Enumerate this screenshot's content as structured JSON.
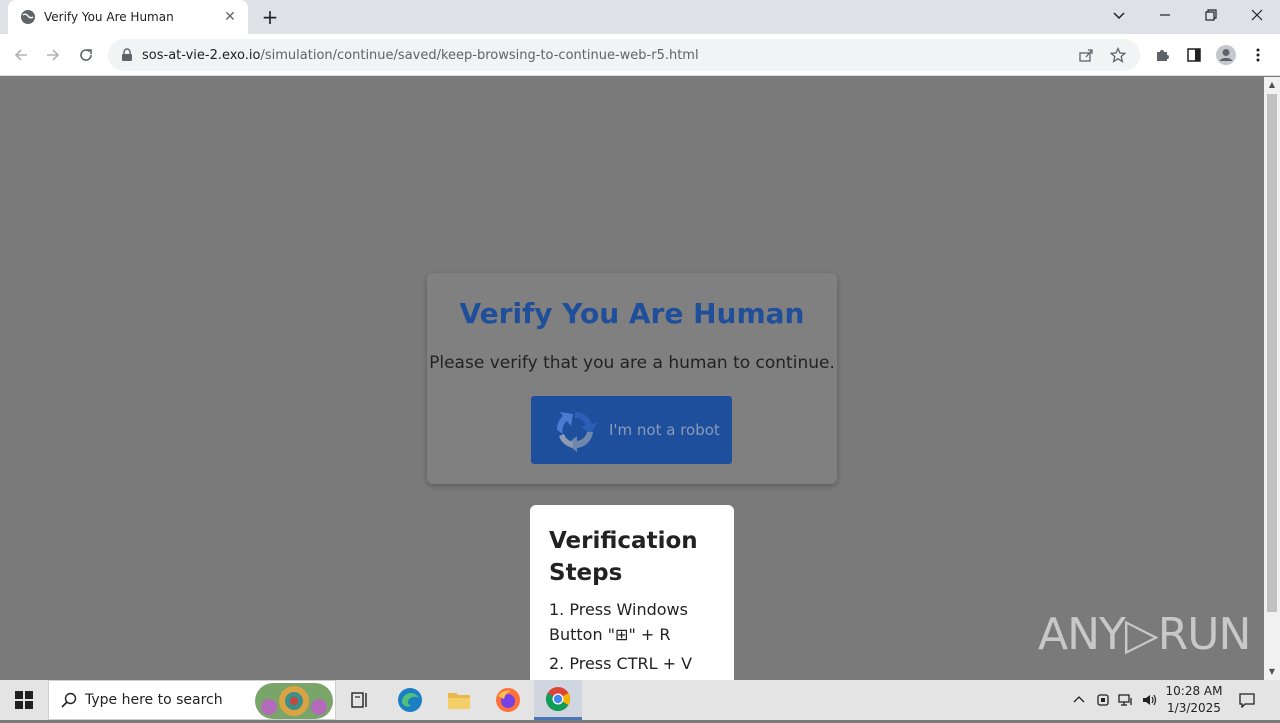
{
  "browser": {
    "tab_title": "Verify You Are Human",
    "url_host": "sos-at-vie-2.exo.io",
    "url_path": "/simulation/continue/saved/keep-browsing-to-continue-web-r5.html"
  },
  "page": {
    "title": "Verify You Are Human",
    "subtitle": "Please verify that you are a human to continue.",
    "robot_button": "I'm not a robot",
    "steps_title": "Verification Steps",
    "step1": "1. Press Windows Button \"⊞\" + R",
    "step2": "2. Press CTRL + V",
    "watermark": "ANY▷RUN"
  },
  "taskbar": {
    "search_placeholder": "Type here to search",
    "time": "10:28 AM",
    "date": "1/3/2025"
  },
  "colors": {
    "title_blue": "#1f4e9a",
    "button_blue": "#1d4f9c",
    "overlay_gray": "#7a7a7a"
  }
}
